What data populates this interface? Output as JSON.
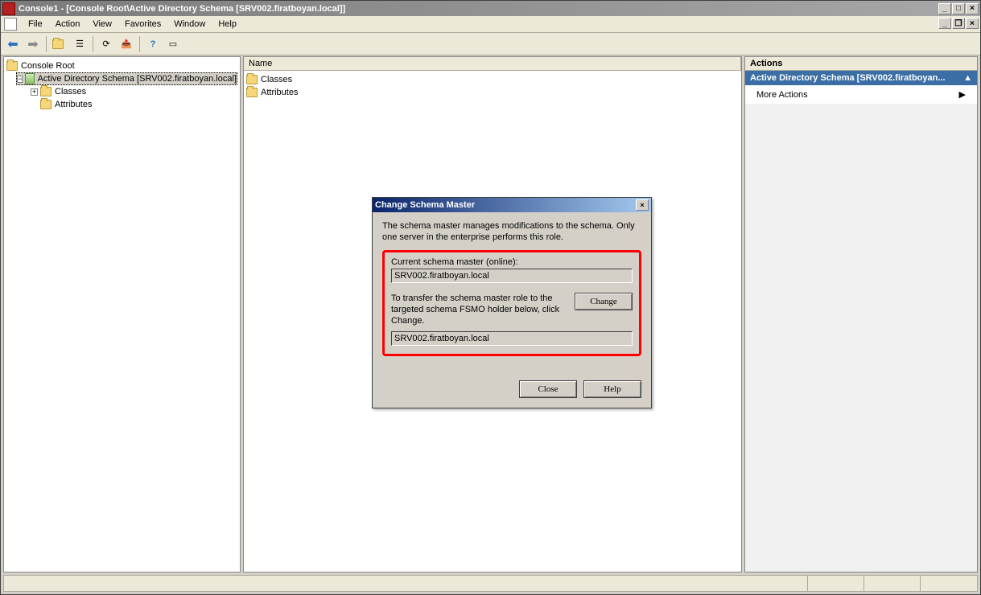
{
  "window": {
    "title": "Console1 - [Console Root\\Active Directory Schema [SRV002.firatboyan.local]]"
  },
  "menu": {
    "items": [
      "File",
      "Action",
      "View",
      "Favorites",
      "Window",
      "Help"
    ]
  },
  "tree": {
    "root": "Console Root",
    "schema_node": "Active Directory Schema [SRV002.firatboyan.local]",
    "children": [
      "Classes",
      "Attributes"
    ]
  },
  "list": {
    "header": "Name",
    "rows": [
      "Classes",
      "Attributes"
    ]
  },
  "actions": {
    "header": "Actions",
    "section": "Active Directory Schema [SRV002.firatboyan...",
    "more": "More Actions"
  },
  "dialog": {
    "title": "Change Schema Master",
    "intro": "The schema master manages modifications to the schema. Only one server in the enterprise performs this role.",
    "current_label": "Current schema master (online):",
    "current_value": "SRV002.firatboyan.local",
    "transfer_text": "To transfer the schema master role to the targeted schema FSMO holder below, click Change.",
    "change_btn": "Change",
    "target_value": "SRV002.firatboyan.local",
    "close_btn": "Close",
    "help_btn": "Help"
  }
}
